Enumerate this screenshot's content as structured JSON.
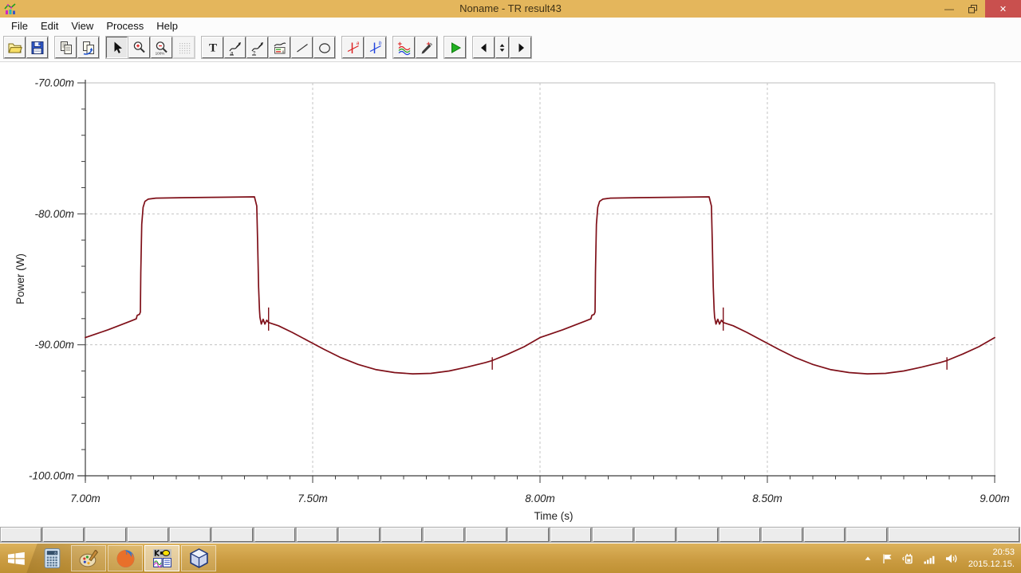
{
  "window": {
    "title": "Noname - TR result43",
    "icon": "tina-diagram-icon",
    "controls": {
      "minimize": "–",
      "restore": "restore",
      "close": "✕"
    }
  },
  "menu": {
    "items": [
      "File",
      "Edit",
      "View",
      "Process",
      "Help"
    ]
  },
  "toolbar": {
    "groups": [
      [
        "open",
        "save"
      ],
      [
        "copy",
        "copy-special"
      ],
      [
        "select",
        "zoom-in",
        "zoom-out-100",
        "grid"
      ],
      [
        "text",
        "marker-a",
        "marker-help",
        "legend",
        "line",
        "ellipse"
      ],
      [
        "cursor-a",
        "cursor-b"
      ],
      [
        "add-curves",
        "picker"
      ],
      [
        "run"
      ],
      [
        "prev-page",
        "page-spinner",
        "next-page"
      ]
    ],
    "pressed": "select",
    "disabled": "grid",
    "zoom_out_label": "100%"
  },
  "chart_data": {
    "type": "line",
    "title": "",
    "xlabel": "Time (s)",
    "ylabel": "Power (W)",
    "x_unit": "ms",
    "y_unit": "mW",
    "xlim": [
      7.0,
      9.0
    ],
    "ylim": [
      -100,
      -70
    ],
    "x_tick_labels": [
      "7.00m",
      "7.50m",
      "8.00m",
      "8.50m",
      "9.00m"
    ],
    "y_tick_labels": [
      "-70.00m",
      "-80.00m",
      "-90.00m",
      "-100.00m"
    ],
    "x_minor_step": 0.05,
    "y_minor_step": 2,
    "grid": "dashed",
    "legend_position": "none",
    "series": [
      {
        "name": "power",
        "color": "#7f1019",
        "points": [
          [
            7.0,
            -89.45
          ],
          [
            7.025,
            -89.15
          ],
          [
            7.05,
            -88.85
          ],
          [
            7.075,
            -88.52
          ],
          [
            7.1,
            -88.18
          ],
          [
            7.112,
            -88.02
          ],
          [
            7.114,
            -87.75
          ],
          [
            7.119,
            -87.68
          ],
          [
            7.121,
            -87.5
          ],
          [
            7.122,
            -84.5
          ],
          [
            7.124,
            -80.8
          ],
          [
            7.127,
            -79.5
          ],
          [
            7.131,
            -79.05
          ],
          [
            7.138,
            -78.88
          ],
          [
            7.155,
            -78.8
          ],
          [
            7.22,
            -78.76
          ],
          [
            7.3,
            -78.73
          ],
          [
            7.372,
            -78.7
          ],
          [
            7.377,
            -79.4
          ],
          [
            7.379,
            -82.2
          ],
          [
            7.381,
            -85.6
          ],
          [
            7.383,
            -87.35
          ],
          [
            7.384,
            -87.9
          ],
          [
            7.387,
            -88.42
          ],
          [
            7.391,
            -88.05
          ],
          [
            7.395,
            -88.42
          ],
          [
            7.399,
            -88.12
          ],
          [
            7.403,
            -88.3
          ],
          [
            7.425,
            -88.55
          ],
          [
            7.455,
            -89.05
          ],
          [
            7.49,
            -89.7
          ],
          [
            7.525,
            -90.35
          ],
          [
            7.56,
            -90.95
          ],
          [
            7.6,
            -91.5
          ],
          [
            7.64,
            -91.9
          ],
          [
            7.68,
            -92.12
          ],
          [
            7.72,
            -92.22
          ],
          [
            7.76,
            -92.18
          ],
          [
            7.8,
            -92.0
          ],
          [
            7.84,
            -91.7
          ],
          [
            7.88,
            -91.35
          ],
          [
            7.895,
            -91.2
          ],
          [
            7.93,
            -90.7
          ],
          [
            7.965,
            -90.15
          ],
          [
            8.0,
            -89.45
          ],
          [
            8.025,
            -89.15
          ],
          [
            8.05,
            -88.85
          ],
          [
            8.075,
            -88.52
          ],
          [
            8.1,
            -88.18
          ],
          [
            8.112,
            -88.02
          ],
          [
            8.114,
            -87.75
          ],
          [
            8.119,
            -87.68
          ],
          [
            8.121,
            -87.5
          ],
          [
            8.122,
            -84.5
          ],
          [
            8.124,
            -80.8
          ],
          [
            8.127,
            -79.5
          ],
          [
            8.131,
            -79.05
          ],
          [
            8.138,
            -78.88
          ],
          [
            8.155,
            -78.8
          ],
          [
            8.22,
            -78.76
          ],
          [
            8.3,
            -78.73
          ],
          [
            8.372,
            -78.7
          ],
          [
            8.377,
            -79.4
          ],
          [
            8.379,
            -82.2
          ],
          [
            8.381,
            -85.6
          ],
          [
            8.383,
            -87.35
          ],
          [
            8.384,
            -87.9
          ],
          [
            8.387,
            -88.42
          ],
          [
            8.391,
            -88.05
          ],
          [
            8.395,
            -88.42
          ],
          [
            8.399,
            -88.12
          ],
          [
            8.403,
            -88.3
          ],
          [
            8.425,
            -88.55
          ],
          [
            8.455,
            -89.05
          ],
          [
            8.49,
            -89.7
          ],
          [
            8.525,
            -90.35
          ],
          [
            8.56,
            -90.95
          ],
          [
            8.6,
            -91.5
          ],
          [
            8.64,
            -91.9
          ],
          [
            8.68,
            -92.12
          ],
          [
            8.72,
            -92.22
          ],
          [
            8.76,
            -92.18
          ],
          [
            8.8,
            -92.0
          ],
          [
            8.84,
            -91.7
          ],
          [
            8.88,
            -91.35
          ],
          [
            8.895,
            -91.2
          ],
          [
            8.93,
            -90.7
          ],
          [
            8.965,
            -90.15
          ],
          [
            9.0,
            -89.45
          ]
        ],
        "glitch_spikes": [
          [
            7.403,
            -87.15,
            -88.92
          ],
          [
            7.895,
            -90.95,
            -91.9
          ],
          [
            8.403,
            -87.15,
            -88.92
          ],
          [
            8.895,
            -90.95,
            -91.9
          ]
        ]
      }
    ]
  },
  "page_tabs": {
    "count": 21,
    "wide_last": true
  },
  "taskbar": {
    "start": "start-button",
    "apps": [
      {
        "name": "calculator",
        "state": "pinned"
      },
      {
        "name": "paint",
        "state": "running"
      },
      {
        "name": "firefox",
        "state": "running"
      },
      {
        "name": "tina",
        "state": "active"
      },
      {
        "name": "virtualbox",
        "state": "running"
      }
    ],
    "tray": {
      "icons": [
        "hidden-icons",
        "action-center",
        "power",
        "network",
        "volume"
      ],
      "time": "20:53",
      "date": "2015.12.15."
    }
  },
  "colors": {
    "titlebar": "#e4b65c",
    "close_button": "#c9504e",
    "trace": "#7f1019",
    "taskbar_top": "#dcb25c",
    "taskbar_bottom": "#bf9133"
  }
}
